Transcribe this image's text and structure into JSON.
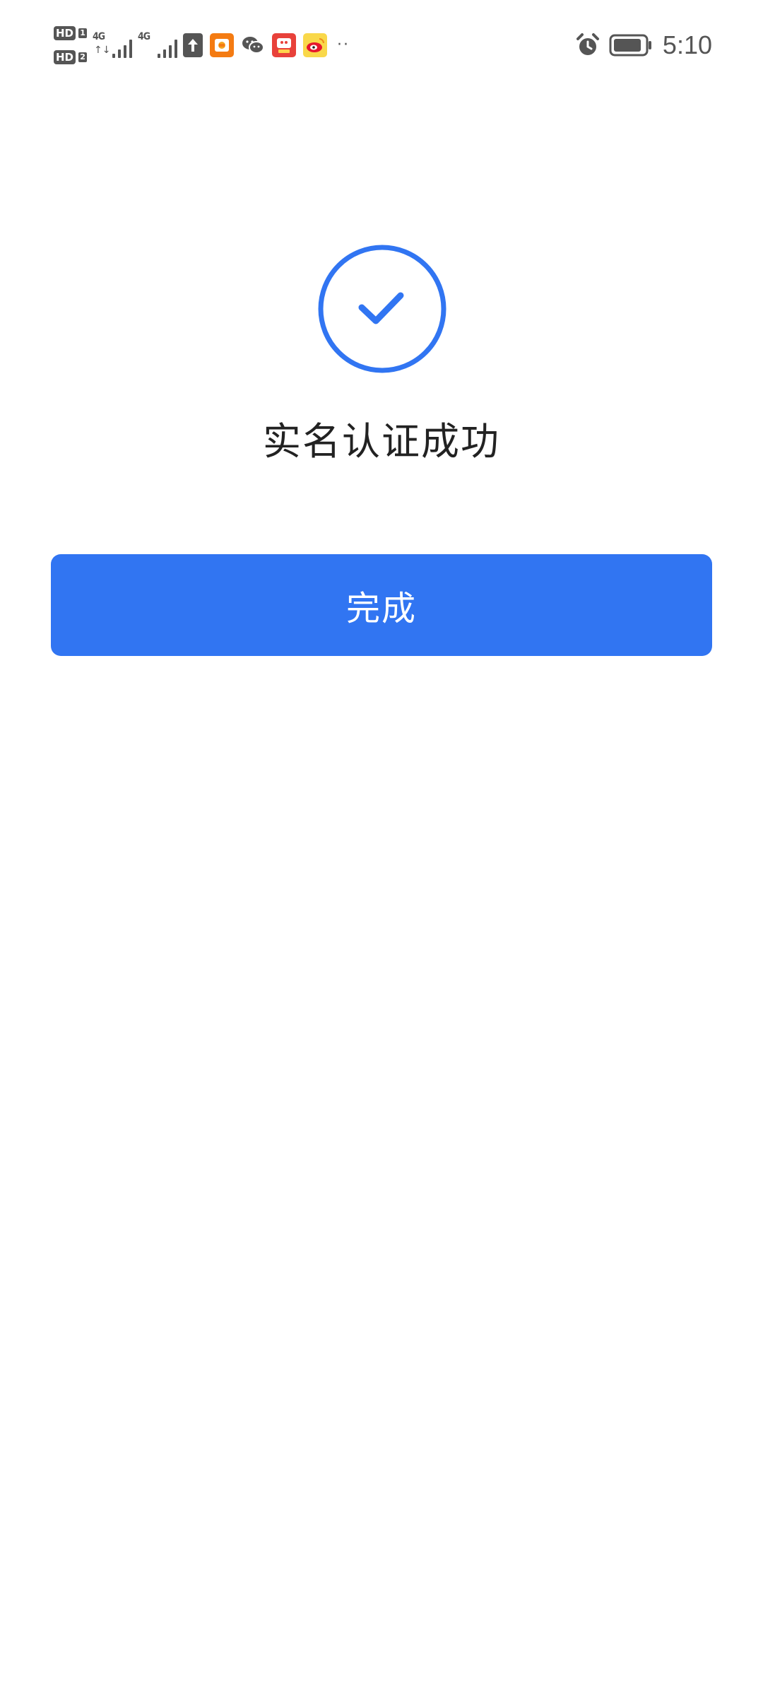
{
  "status_bar": {
    "sim1_label": "HD",
    "sim1_num": "1",
    "sim2_label": "HD",
    "sim2_num": "2",
    "net1_type": "4G",
    "net1_arrows": "↑↓",
    "net2_type": "4G",
    "more_indicator": "··",
    "time": "5:10",
    "icons": [
      "upload-icon",
      "app-icon-orange",
      "wechat-icon",
      "app-icon-red",
      "weibo-icon",
      "alarm-icon",
      "battery-icon"
    ]
  },
  "result": {
    "title": "实名认证成功",
    "icon": "check-circle-icon",
    "accent_color": "#3175f2"
  },
  "actions": {
    "done_label": "完成"
  }
}
